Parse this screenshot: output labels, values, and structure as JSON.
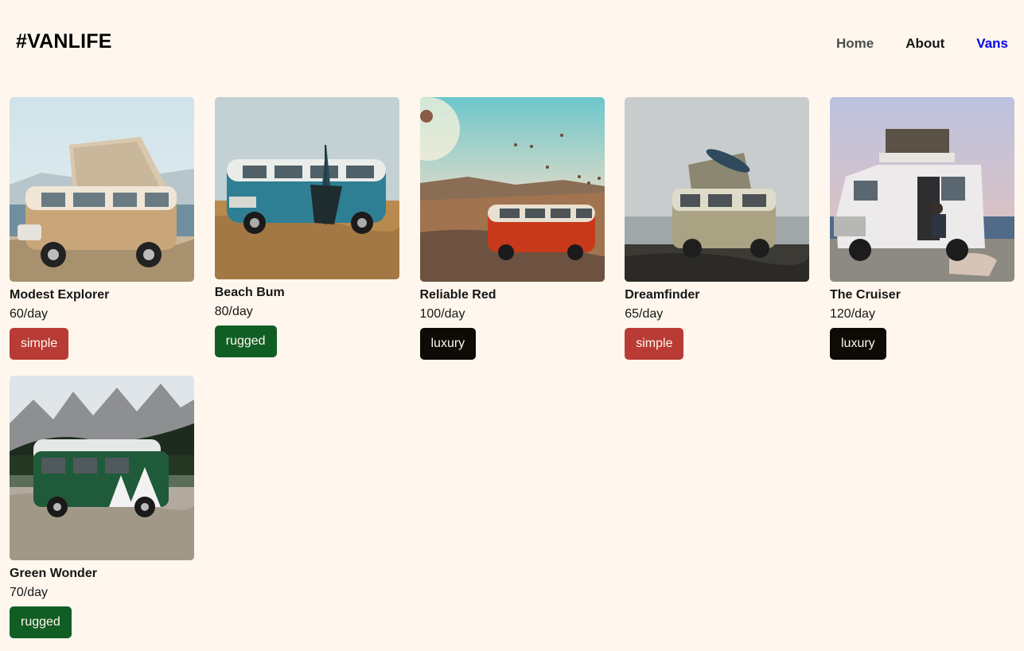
{
  "header": {
    "logo": "#VANLIFE",
    "nav": [
      {
        "label": "Home"
      },
      {
        "label": "About"
      },
      {
        "label": "Vans"
      }
    ]
  },
  "vans": [
    {
      "name": "Modest Explorer",
      "price": "60/day",
      "type": "simple",
      "image": "beige-vw-pop-top-van-icon"
    },
    {
      "name": "Beach Bum",
      "price": "80/day",
      "type": "rugged",
      "image": "teal-vw-bus-icon"
    },
    {
      "name": "Reliable Red",
      "price": "100/day",
      "type": "luxury",
      "image": "red-vw-bus-balloons-icon"
    },
    {
      "name": "Dreamfinder",
      "price": "65/day",
      "type": "simple",
      "image": "cream-pop-top-van-icon"
    },
    {
      "name": "The Cruiser",
      "price": "120/day",
      "type": "luxury",
      "image": "white-camper-van-icon"
    },
    {
      "name": "Green Wonder",
      "price": "70/day",
      "type": "rugged",
      "image": "green-vw-van-mountains-icon"
    }
  ],
  "colors": {
    "background": "#FFF7ED",
    "simple": "#B93B35",
    "rugged": "#115E25",
    "luxury": "#0E0A05",
    "active_link": "#0000EE"
  }
}
